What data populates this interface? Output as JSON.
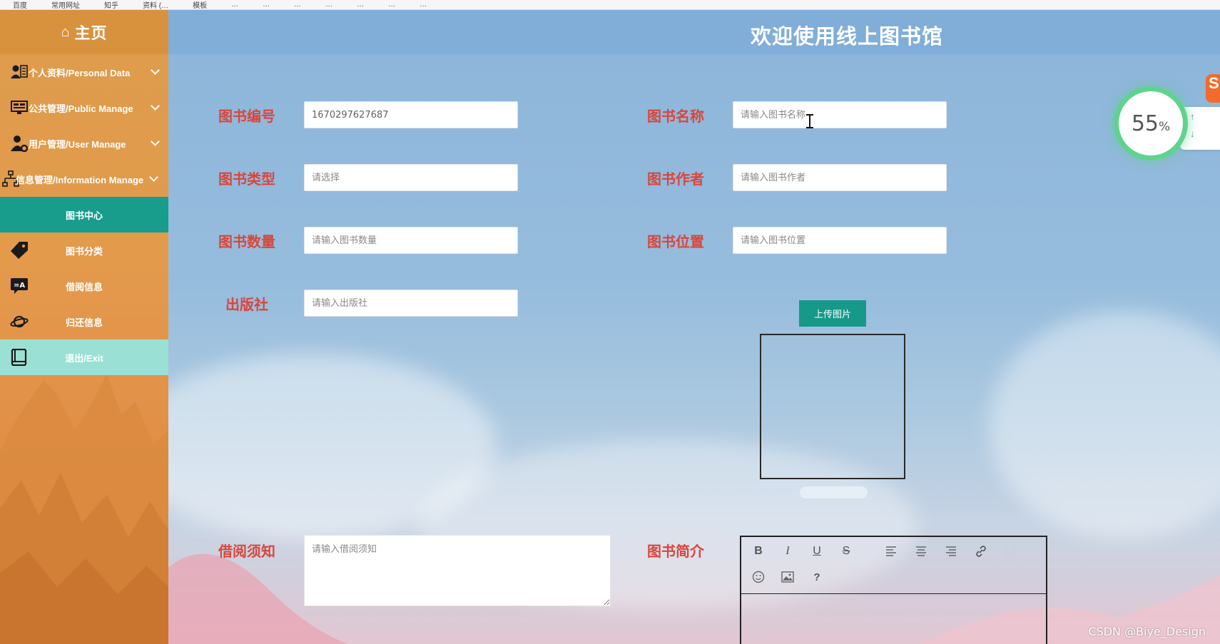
{
  "browser": {
    "bookmarks": [
      "百度",
      "常用网址",
      "知乎",
      "资料 (…",
      "模板",
      "…",
      "…",
      "…",
      "…",
      "…",
      "…",
      "…"
    ]
  },
  "sidebar": {
    "home_label": "主页",
    "items": [
      {
        "label": "个人资料/Personal Data",
        "icon": "user-card-icon"
      },
      {
        "label": "公共管理/Public Manage",
        "icon": "monitor-icon"
      },
      {
        "label": "用户管理/User Manage",
        "icon": "user-gear-icon"
      },
      {
        "label": "信息管理/Information Manage",
        "icon": "org-chart-icon"
      },
      {
        "label": "图书中心"
      },
      {
        "label": "图书分类",
        "icon": "tag-icon"
      },
      {
        "label": "借阅信息",
        "icon": "translate-icon"
      },
      {
        "label": "归还信息",
        "icon": "planet-icon"
      },
      {
        "label": "退出/Exit",
        "icon": "book-icon"
      }
    ]
  },
  "header": {
    "title": "欢迎使用线上图书馆"
  },
  "form": {
    "book_id_label": "图书编号",
    "book_id_value": "1670297627687",
    "book_name_label": "图书名称",
    "book_name_placeholder": "请输入图书名称",
    "book_type_label": "图书类型",
    "book_type_placeholder": "请选择",
    "book_author_label": "图书作者",
    "book_author_placeholder": "请输入图书作者",
    "book_qty_label": "图书数量",
    "book_qty_placeholder": "请输入图书数量",
    "book_location_label": "图书位置",
    "book_location_placeholder": "请输入图书位置",
    "publisher_label": "出版社",
    "publisher_placeholder": "请输入出版社",
    "upload_label": "上传图片",
    "borrow_notice_label": "借阅须知",
    "borrow_notice_placeholder": "请输入借阅须知",
    "book_intro_label": "图书简介"
  },
  "editor": {
    "toolbar": [
      "B",
      "I",
      "U",
      "S",
      "?"
    ]
  },
  "widget": {
    "speed_value": "55",
    "speed_unit": "%"
  },
  "watermark": "CSDN @Biye_Design"
}
